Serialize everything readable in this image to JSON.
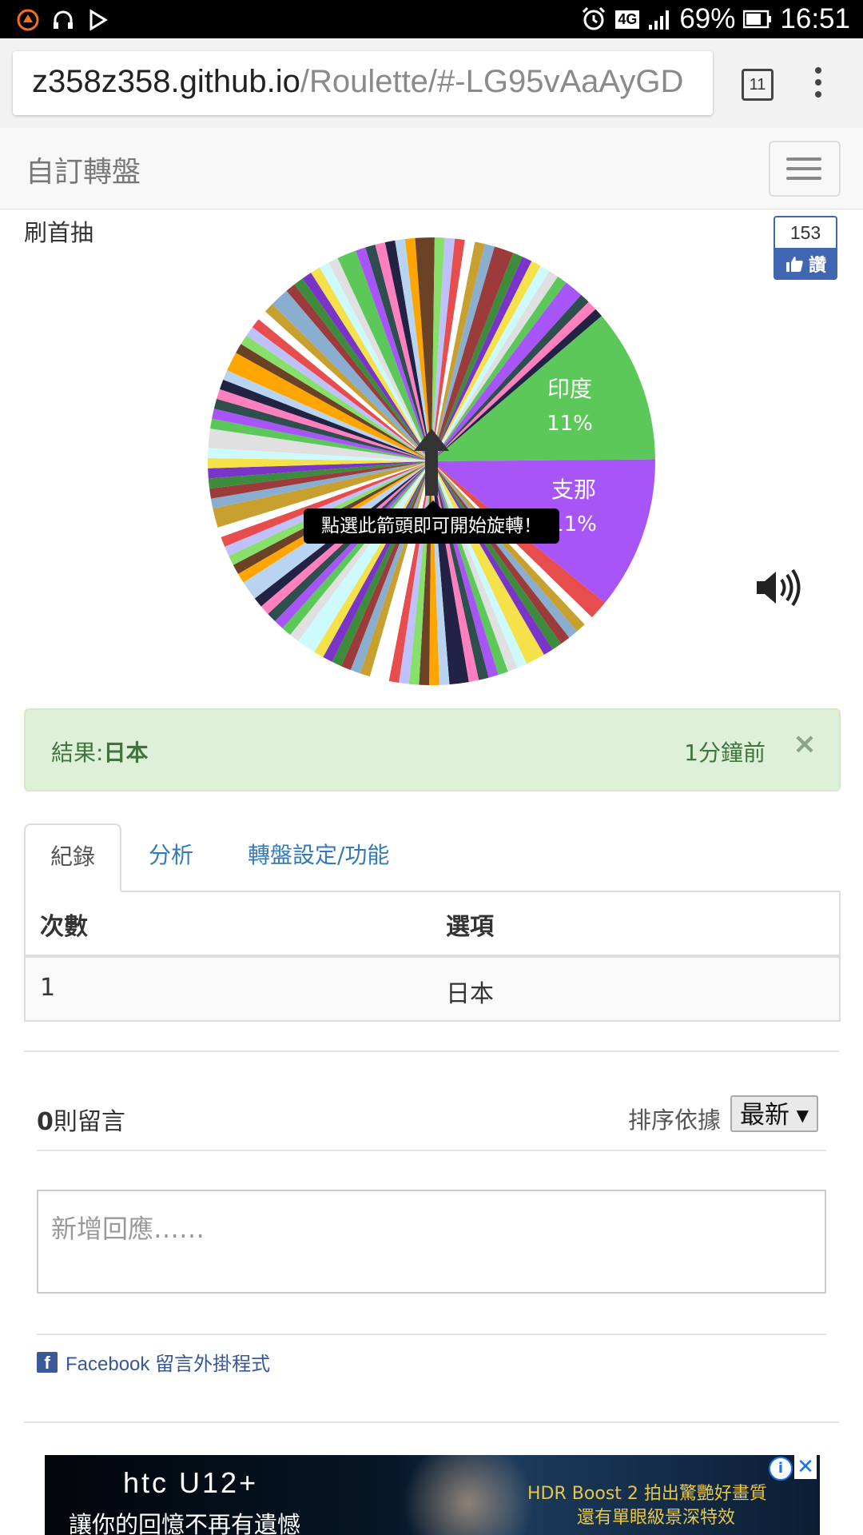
{
  "status_bar": {
    "battery_percent": "69%",
    "time": "16:51",
    "network": "4G"
  },
  "browser": {
    "url_host": "z358z358.github.io",
    "url_path": "/Roulette/#-LG95vAaAyGD",
    "tab_count": "11"
  },
  "navbar": {
    "brand": "自訂轉盤"
  },
  "wheel": {
    "title": "刷首抽",
    "likes": "153",
    "like_label": "讚",
    "tooltip": "點選此箭頭即可開始旋轉！",
    "labeled_slices": [
      {
        "label": "印度",
        "percent": "11%",
        "color": "#5cc85a"
      },
      {
        "label": "支那",
        "percent": "11%",
        "color": "#a855f7"
      }
    ]
  },
  "result": {
    "prefix": "結果:",
    "value": "日本",
    "time_ago": "1分鐘前",
    "close": "×"
  },
  "tabs": [
    {
      "label": "紀錄",
      "active": true
    },
    {
      "label": "分析",
      "active": false
    },
    {
      "label": "轉盤設定/功能",
      "active": false
    }
  ],
  "history_table": {
    "headers": [
      "次數",
      "選項"
    ],
    "rows": [
      [
        "1",
        "日本"
      ]
    ]
  },
  "comments": {
    "count": "0",
    "count_suffix": "則留言",
    "sort_label": "排序依據",
    "sort_value": "最新",
    "placeholder": "新增回應……",
    "plugin_label": "Facebook 留言外掛程式"
  },
  "ad": {
    "brand": "htc U12+",
    "slogan": "讓你的回憶不再有遺憾",
    "promo_line1": "HDR Boost 2 拍出驚艷好畫質",
    "promo_line2": "還有單眼級景深特效"
  }
}
